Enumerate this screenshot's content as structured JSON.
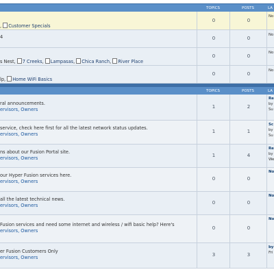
{
  "section1": {
    "headers": {
      "topics": "TOPICS",
      "posts": "POSTS",
      "last": "LA"
    },
    "rows": [
      {
        "text": ", ",
        "subforum": "Customer Specials",
        "topics": "0",
        "posts": "0",
        "last": "No"
      },
      {
        "text": "4",
        "topics": "0",
        "posts": "0",
        "last": "No"
      },
      {
        "text": "s Nest, ",
        "subs": [
          "7 Creeks",
          "Lampasas",
          "Chica Ranch",
          "River Place"
        ],
        "topics": "0",
        "posts": "0",
        "last": "No"
      },
      {
        "text": "lp, ",
        "subforum": "Home WiFi Basics",
        "topics": "0",
        "posts": "0",
        "last": "No"
      }
    ]
  },
  "section2": {
    "headers": {
      "topics": "TOPICS",
      "posts": "POSTS",
      "last": "LA"
    },
    "rows": [
      {
        "desc": "ral announcements.",
        "mods": "ervisors, Owners",
        "topics": "1",
        "posts": "2",
        "last": [
          "Re",
          "by",
          "Su"
        ]
      },
      {
        "desc": " service, check here first for all the latest network status updates.",
        "mods": "ervisors, Owners",
        "topics": "1",
        "posts": "1",
        "last": [
          "Sc",
          "by",
          "Su"
        ]
      },
      {
        "desc": "ns about our Fusion Portal site.",
        "mods": "ervisors, Owners",
        "topics": "1",
        "posts": "4",
        "last": [
          "Re",
          "by",
          "We"
        ]
      },
      {
        "desc": "our Hyper Fusion services here.",
        "mods": "ervisors, Owners",
        "topics": "0",
        "posts": "0",
        "last": [
          "No"
        ]
      },
      {
        "desc": "all the latest technical news.",
        "mods": "ervisors, Owners",
        "topics": "0",
        "posts": "0",
        "last": [
          "No"
        ]
      },
      {
        "desc": " Fusion services and need some internet and wireless / wifi basic help? Here's",
        "mods": "ervisors, Owners",
        "topics": "0",
        "posts": "0",
        "last": [
          "No"
        ]
      },
      {
        "desc": "er Fusion Customers Only",
        "mods": "ervisors, Owners",
        "topics": "3",
        "posts": "3",
        "last": [
          "by",
          "Fri"
        ]
      }
    ]
  },
  "colors": {
    "header": "#5a8fc8",
    "row": "#e9eff5",
    "row_alt": "#eef2f6",
    "highlight": "#f8f6d6",
    "link": "#1e5aa0"
  }
}
